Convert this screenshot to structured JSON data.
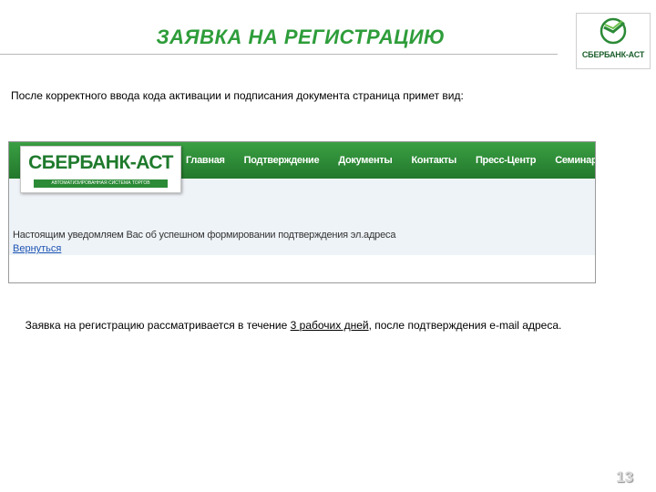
{
  "slide": {
    "title": "ЗАЯВКА НА РЕГИСТРАЦИЮ",
    "logo_text": "СБЕРБАНК-АСТ",
    "intro": "После корректного ввода кода активации и подписания документа страница примет вид:",
    "caption_part1": "Заявка на регистрацию рассматривается в течение ",
    "caption_link": "3 рабочих дней",
    "caption_part2": ", после подтверждения e-mail адреса.",
    "page_number": "13"
  },
  "screenshot": {
    "site_logo": "СБЕРБАНК-АСТ",
    "site_logo_sub": "АВТОМАТИЗИРОВАННАЯ СИСТЕМА ТОРГОВ",
    "nav": [
      "Главная",
      "Подтверждение",
      "Документы",
      "Контакты",
      "Пресс-Центр",
      "Семинары"
    ],
    "notice": "Настоящим уведомляем Вас об успешном формировании подтверждения эл.адреса",
    "back_link": "Вернуться"
  },
  "colors": {
    "brand_green": "#2b8a36",
    "title_green": "#2e9d3a",
    "link_blue": "#1f55b5"
  }
}
